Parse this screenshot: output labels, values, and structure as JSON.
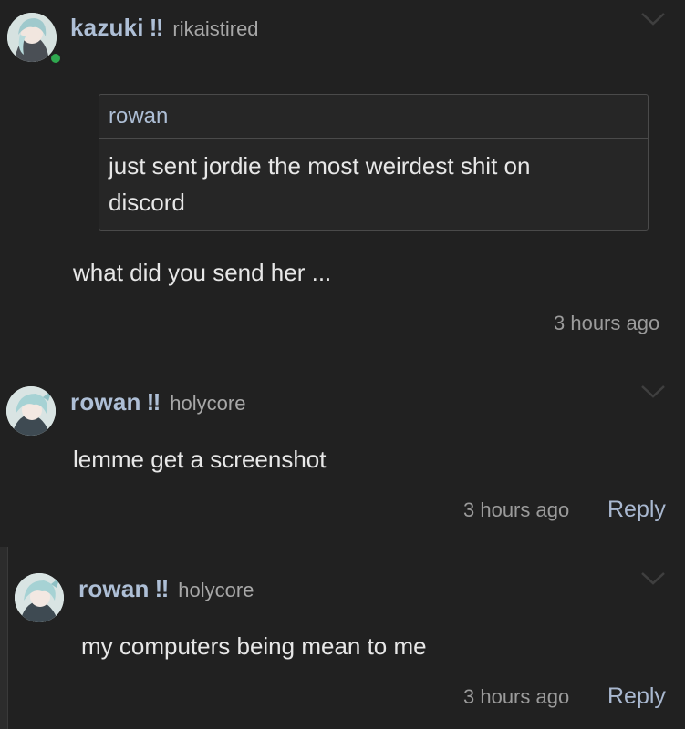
{
  "comments": [
    {
      "display_name": "kazuki",
      "handle": "rikaistired",
      "quote": {
        "author": "rowan",
        "text": "just sent jordie the most weirdest shit on discord"
      },
      "body": "what did you send her ...",
      "time": "3 hours ago",
      "online": true
    },
    {
      "display_name": "rowan",
      "handle": "holycore",
      "body": "lemme get a screenshot",
      "time": "3 hours ago",
      "reply": "Reply"
    },
    {
      "display_name": "rowan",
      "handle": "holycore",
      "body": "my computers being mean to me",
      "time": "3 hours ago",
      "reply": "Reply"
    }
  ],
  "badge_glyph": "‼",
  "colors": {
    "background": "#212121",
    "name": "#aebfd6",
    "online": "#2fa84f",
    "muted": "#9b9b9b"
  },
  "icons": [
    "avatar-icon",
    "chevron-down-icon"
  ]
}
